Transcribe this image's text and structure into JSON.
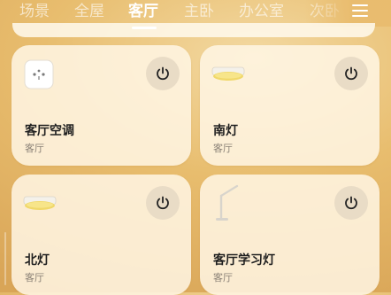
{
  "tabs": [
    {
      "label": "场景"
    },
    {
      "label": "全屋"
    },
    {
      "label": "客厅"
    },
    {
      "label": "主卧"
    },
    {
      "label": "办公室"
    },
    {
      "label": "次卧"
    }
  ],
  "active_tab": "客厅",
  "devices": [
    {
      "name": "客厅空调",
      "room": "客厅",
      "icon": "air-conditioner-plug-icon"
    },
    {
      "name": "南灯",
      "room": "客厅",
      "icon": "ceiling-light-icon"
    },
    {
      "name": "北灯",
      "room": "客厅",
      "icon": "ceiling-light-icon"
    },
    {
      "name": "客厅学习灯",
      "room": "客厅",
      "icon": "desk-lamp-icon"
    }
  ],
  "colors": {
    "accent": "#ffffff",
    "card_bg": "#fff6e4",
    "background": "#e8bd6e"
  }
}
